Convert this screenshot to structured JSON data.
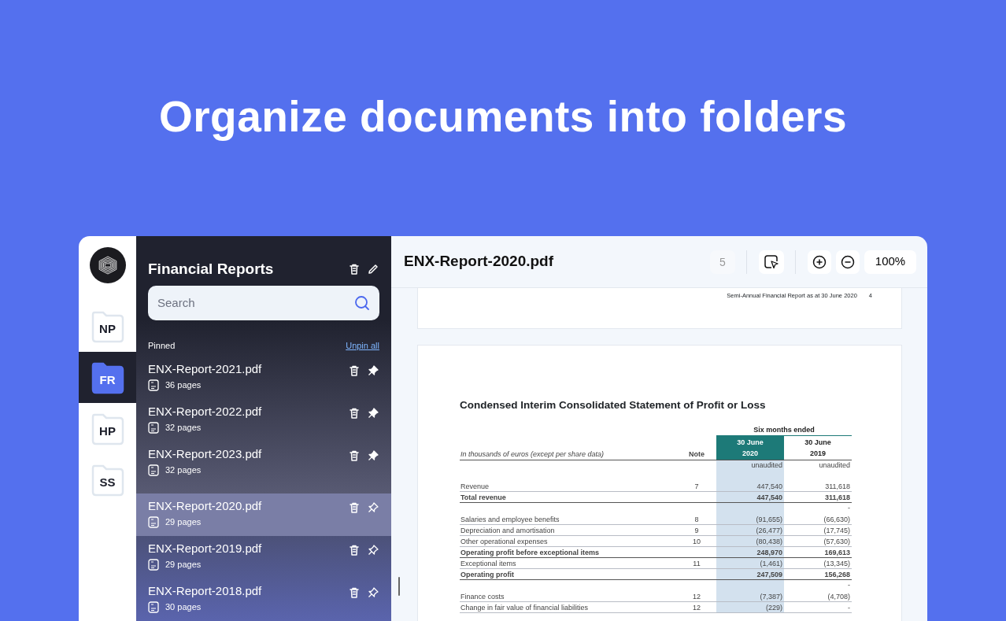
{
  "headline": "Organize documents into folders",
  "rail": {
    "folders": [
      {
        "label": "NP",
        "selected": false
      },
      {
        "label": "FR",
        "selected": true
      },
      {
        "label": "HP",
        "selected": false
      },
      {
        "label": "SS",
        "selected": false
      }
    ]
  },
  "sidebar": {
    "title": "Financial Reports",
    "search": {
      "placeholder": "Search"
    },
    "pinned_label": "Pinned",
    "unpin_all": "Unpin all",
    "files": [
      {
        "name": "ENX-Report-2021.pdf",
        "pages": "36 pages",
        "pinned": true,
        "selected": false
      },
      {
        "name": "ENX-Report-2022.pdf",
        "pages": "32 pages",
        "pinned": true,
        "selected": false
      },
      {
        "name": "ENX-Report-2023.pdf",
        "pages": "32 pages",
        "pinned": true,
        "selected": false
      },
      {
        "name": "ENX-Report-2020.pdf",
        "pages": "29 pages",
        "pinned": false,
        "selected": true
      },
      {
        "name": "ENX-Report-2019.pdf",
        "pages": "29 pages",
        "pinned": false,
        "selected": false
      },
      {
        "name": "ENX-Report-2018.pdf",
        "pages": "30 pages",
        "pinned": false,
        "selected": false
      }
    ]
  },
  "viewer": {
    "title": "ENX-Report-2020.pdf",
    "page": "5",
    "zoom": "100%",
    "page_footer": "Semi-Annual Financial Report as at 30 June 2020",
    "page_footer_number": "4",
    "statement": {
      "title": "Condensed Interim Consolidated Statement of Profit or Loss",
      "group_header": "Six months ended",
      "caption": "In thousands of euros (except per share data)",
      "note_header": "Note",
      "columns": [
        {
          "line1": "30 June",
          "line2": "2020",
          "highlighted": true
        },
        {
          "line1": "30 June",
          "line2": "2019",
          "highlighted": false
        }
      ],
      "audit": [
        "unaudited",
        "unaudited"
      ],
      "rows": [
        {
          "kind": "line",
          "label": "Revenue",
          "note": "7",
          "values": [
            "447,540",
            "311,618"
          ],
          "bold": false
        },
        {
          "kind": "line",
          "label": "Total revenue",
          "values": [
            "447,540",
            "311,618"
          ],
          "bold": true
        },
        {
          "kind": "dash",
          "text": "-"
        },
        {
          "kind": "line",
          "label": "Salaries and employee benefits",
          "note": "8",
          "values": [
            "(91,655)",
            "(66,630)"
          ],
          "bold": false
        },
        {
          "kind": "line",
          "label": "Depreciation and amortisation",
          "note": "9",
          "values": [
            "(26,477)",
            "(17,745)"
          ],
          "bold": false
        },
        {
          "kind": "line",
          "label": "Other operational expenses",
          "note": "10",
          "values": [
            "(80,438)",
            "(57,630)"
          ],
          "bold": false
        },
        {
          "kind": "line",
          "label": "Operating profit before exceptional items",
          "values": [
            "248,970",
            "169,613"
          ],
          "bold": true
        },
        {
          "kind": "line",
          "label": "Exceptional items",
          "note": "11",
          "values": [
            "(1,461)",
            "(13,345)"
          ],
          "bold": false
        },
        {
          "kind": "line",
          "label": "Operating profit",
          "values": [
            "247,509",
            "156,268"
          ],
          "bold": true
        },
        {
          "kind": "dash",
          "text": "-"
        },
        {
          "kind": "line",
          "label": "Finance costs",
          "note": "12",
          "values": [
            "(7,387)",
            "(4,708)"
          ],
          "bold": false
        },
        {
          "kind": "line",
          "label": "Change in fair value of financial liabilities",
          "note": "12",
          "values": [
            "(229)",
            "-"
          ],
          "bold": false
        }
      ]
    }
  }
}
